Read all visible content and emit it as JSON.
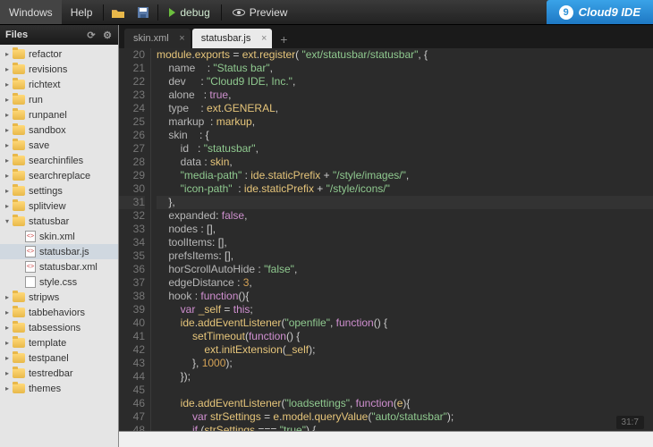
{
  "topbar": {
    "menu": [
      "Windows",
      "Help"
    ],
    "debug": "debug",
    "preview": "Preview",
    "logo": "Cloud9 IDE",
    "logo_glyph": "9"
  },
  "sidebar": {
    "title": "Files",
    "items": [
      {
        "type": "folder",
        "name": "refactor",
        "arrow": "▸"
      },
      {
        "type": "folder",
        "name": "revisions",
        "arrow": "▸"
      },
      {
        "type": "folder",
        "name": "richtext",
        "arrow": "▸"
      },
      {
        "type": "folder",
        "name": "run",
        "arrow": "▸"
      },
      {
        "type": "folder",
        "name": "runpanel",
        "arrow": "▸"
      },
      {
        "type": "folder",
        "name": "sandbox",
        "arrow": "▸"
      },
      {
        "type": "folder",
        "name": "save",
        "arrow": "▸"
      },
      {
        "type": "folder",
        "name": "searchinfiles",
        "arrow": "▸"
      },
      {
        "type": "folder",
        "name": "searchreplace",
        "arrow": "▸"
      },
      {
        "type": "folder",
        "name": "settings",
        "arrow": "▸"
      },
      {
        "type": "folder",
        "name": "splitview",
        "arrow": "▸"
      },
      {
        "type": "folder",
        "name": "statusbar",
        "arrow": "▾",
        "expanded": true
      },
      {
        "type": "file",
        "name": "skin.xml",
        "indent": 1,
        "ext": "<>"
      },
      {
        "type": "file",
        "name": "statusbar.js",
        "indent": 1,
        "ext": "<>",
        "selected": true
      },
      {
        "type": "file",
        "name": "statusbar.xml",
        "indent": 1,
        "ext": "<>"
      },
      {
        "type": "file",
        "name": "style.css",
        "indent": 1,
        "ext": ""
      },
      {
        "type": "folder",
        "name": "stripws",
        "arrow": "▸"
      },
      {
        "type": "folder",
        "name": "tabbehaviors",
        "arrow": "▸"
      },
      {
        "type": "folder",
        "name": "tabsessions",
        "arrow": "▸"
      },
      {
        "type": "folder",
        "name": "template",
        "arrow": "▸"
      },
      {
        "type": "folder",
        "name": "testpanel",
        "arrow": "▸"
      },
      {
        "type": "folder",
        "name": "testredbar",
        "arrow": "▸"
      },
      {
        "type": "folder",
        "name": "themes",
        "arrow": "▸"
      }
    ]
  },
  "tabs": [
    {
      "label": "skin.xml",
      "active": false
    },
    {
      "label": "statusbar.js",
      "active": true
    }
  ],
  "editor": {
    "first_line": 20,
    "lines": [
      [
        [
          "id",
          "module"
        ],
        [
          "punct",
          "."
        ],
        [
          "id",
          "exports"
        ],
        [
          "punct",
          " = "
        ],
        [
          "id",
          "ext"
        ],
        [
          "punct",
          "."
        ],
        [
          "fn",
          "register"
        ],
        [
          "punct",
          "( "
        ],
        [
          "str",
          "\"ext/statusbar/statusbar\""
        ],
        [
          "punct",
          ", {"
        ]
      ],
      [
        [
          "prop",
          "    name    "
        ],
        [
          "punct",
          ": "
        ],
        [
          "str",
          "\"Status bar\""
        ],
        [
          "punct",
          ","
        ]
      ],
      [
        [
          "prop",
          "    dev     "
        ],
        [
          "punct",
          ": "
        ],
        [
          "str",
          "\"Cloud9 IDE, Inc.\""
        ],
        [
          "punct",
          ","
        ]
      ],
      [
        [
          "prop",
          "    alone   "
        ],
        [
          "punct",
          ": "
        ],
        [
          "bool",
          "true"
        ],
        [
          "punct",
          ","
        ]
      ],
      [
        [
          "prop",
          "    type    "
        ],
        [
          "punct",
          ": "
        ],
        [
          "id",
          "ext"
        ],
        [
          "punct",
          "."
        ],
        [
          "id",
          "GENERAL"
        ],
        [
          "punct",
          ","
        ]
      ],
      [
        [
          "prop",
          "    markup  "
        ],
        [
          "punct",
          ": "
        ],
        [
          "id",
          "markup"
        ],
        [
          "punct",
          ","
        ]
      ],
      [
        [
          "prop",
          "    skin    "
        ],
        [
          "punct",
          ": {"
        ]
      ],
      [
        [
          "prop",
          "        id   "
        ],
        [
          "punct",
          ": "
        ],
        [
          "str",
          "\"statusbar\""
        ],
        [
          "punct",
          ","
        ]
      ],
      [
        [
          "prop",
          "        data "
        ],
        [
          "punct",
          ": "
        ],
        [
          "id",
          "skin"
        ],
        [
          "punct",
          ","
        ]
      ],
      [
        [
          "str",
          "        \"media-path\""
        ],
        [
          "punct",
          " : "
        ],
        [
          "id",
          "ide"
        ],
        [
          "punct",
          "."
        ],
        [
          "id",
          "staticPrefix"
        ],
        [
          "punct",
          " + "
        ],
        [
          "str",
          "\"/style/images/\""
        ],
        [
          "punct",
          ","
        ]
      ],
      [
        [
          "str",
          "        \"icon-path\""
        ],
        [
          "punct",
          "  : "
        ],
        [
          "id",
          "ide"
        ],
        [
          "punct",
          "."
        ],
        [
          "id",
          "staticPrefix"
        ],
        [
          "punct",
          " + "
        ],
        [
          "str",
          "\"/style/icons/\""
        ]
      ],
      [
        [
          "punct",
          "    },"
        ]
      ],
      [
        [
          "prop",
          "    expanded"
        ],
        [
          "punct",
          ": "
        ],
        [
          "bool",
          "false"
        ],
        [
          "punct",
          ","
        ]
      ],
      [
        [
          "prop",
          "    nodes "
        ],
        [
          "punct",
          ": [],"
        ]
      ],
      [
        [
          "prop",
          "    toolItems"
        ],
        [
          "punct",
          ": [],"
        ]
      ],
      [
        [
          "prop",
          "    prefsItems"
        ],
        [
          "punct",
          ": [],"
        ]
      ],
      [
        [
          "prop",
          "    horScrollAutoHide "
        ],
        [
          "punct",
          ": "
        ],
        [
          "str",
          "\"false\""
        ],
        [
          "punct",
          ","
        ]
      ],
      [
        [
          "prop",
          "    edgeDistance "
        ],
        [
          "punct",
          ": "
        ],
        [
          "num",
          "3"
        ],
        [
          "punct",
          ","
        ]
      ],
      [
        [
          "prop",
          "    hook "
        ],
        [
          "punct",
          ": "
        ],
        [
          "kw",
          "function"
        ],
        [
          "punct",
          "(){"
        ]
      ],
      [
        [
          "punct",
          "        "
        ],
        [
          "kw",
          "var"
        ],
        [
          "punct",
          " "
        ],
        [
          "id",
          "_self"
        ],
        [
          "punct",
          " = "
        ],
        [
          "kw",
          "this"
        ],
        [
          "punct",
          ";"
        ]
      ],
      [
        [
          "punct",
          "        "
        ],
        [
          "id",
          "ide"
        ],
        [
          "punct",
          "."
        ],
        [
          "fn",
          "addEventListener"
        ],
        [
          "punct",
          "("
        ],
        [
          "str",
          "\"openfile\""
        ],
        [
          "punct",
          ", "
        ],
        [
          "kw",
          "function"
        ],
        [
          "punct",
          "() {"
        ]
      ],
      [
        [
          "punct",
          "            "
        ],
        [
          "fn",
          "setTimeout"
        ],
        [
          "punct",
          "("
        ],
        [
          "kw",
          "function"
        ],
        [
          "punct",
          "() {"
        ]
      ],
      [
        [
          "punct",
          "                "
        ],
        [
          "id",
          "ext"
        ],
        [
          "punct",
          "."
        ],
        [
          "fn",
          "initExtension"
        ],
        [
          "punct",
          "("
        ],
        [
          "id",
          "_self"
        ],
        [
          "punct",
          ");"
        ]
      ],
      [
        [
          "punct",
          "            }, "
        ],
        [
          "num",
          "1000"
        ],
        [
          "punct",
          ");"
        ]
      ],
      [
        [
          "punct",
          "        });"
        ]
      ],
      [
        [
          "punct",
          ""
        ]
      ],
      [
        [
          "punct",
          "        "
        ],
        [
          "id",
          "ide"
        ],
        [
          "punct",
          "."
        ],
        [
          "fn",
          "addEventListener"
        ],
        [
          "punct",
          "("
        ],
        [
          "str",
          "\"loadsettings\""
        ],
        [
          "punct",
          ", "
        ],
        [
          "kw",
          "function"
        ],
        [
          "punct",
          "("
        ],
        [
          "id",
          "e"
        ],
        [
          "punct",
          "){"
        ]
      ],
      [
        [
          "punct",
          "            "
        ],
        [
          "kw",
          "var"
        ],
        [
          "punct",
          " "
        ],
        [
          "id",
          "strSettings"
        ],
        [
          "punct",
          " = "
        ],
        [
          "id",
          "e"
        ],
        [
          "punct",
          "."
        ],
        [
          "id",
          "model"
        ],
        [
          "punct",
          "."
        ],
        [
          "fn",
          "queryValue"
        ],
        [
          "punct",
          "("
        ],
        [
          "str",
          "\"auto/statusbar\""
        ],
        [
          "punct",
          ");"
        ]
      ],
      [
        [
          "punct",
          "            "
        ],
        [
          "kw",
          "if"
        ],
        [
          "punct",
          " ("
        ],
        [
          "id",
          "strSettings"
        ],
        [
          "punct",
          " === "
        ],
        [
          "str",
          "\"true\""
        ],
        [
          "punct",
          ") {"
        ]
      ]
    ],
    "highlight_line": 11
  },
  "status": "31:7"
}
